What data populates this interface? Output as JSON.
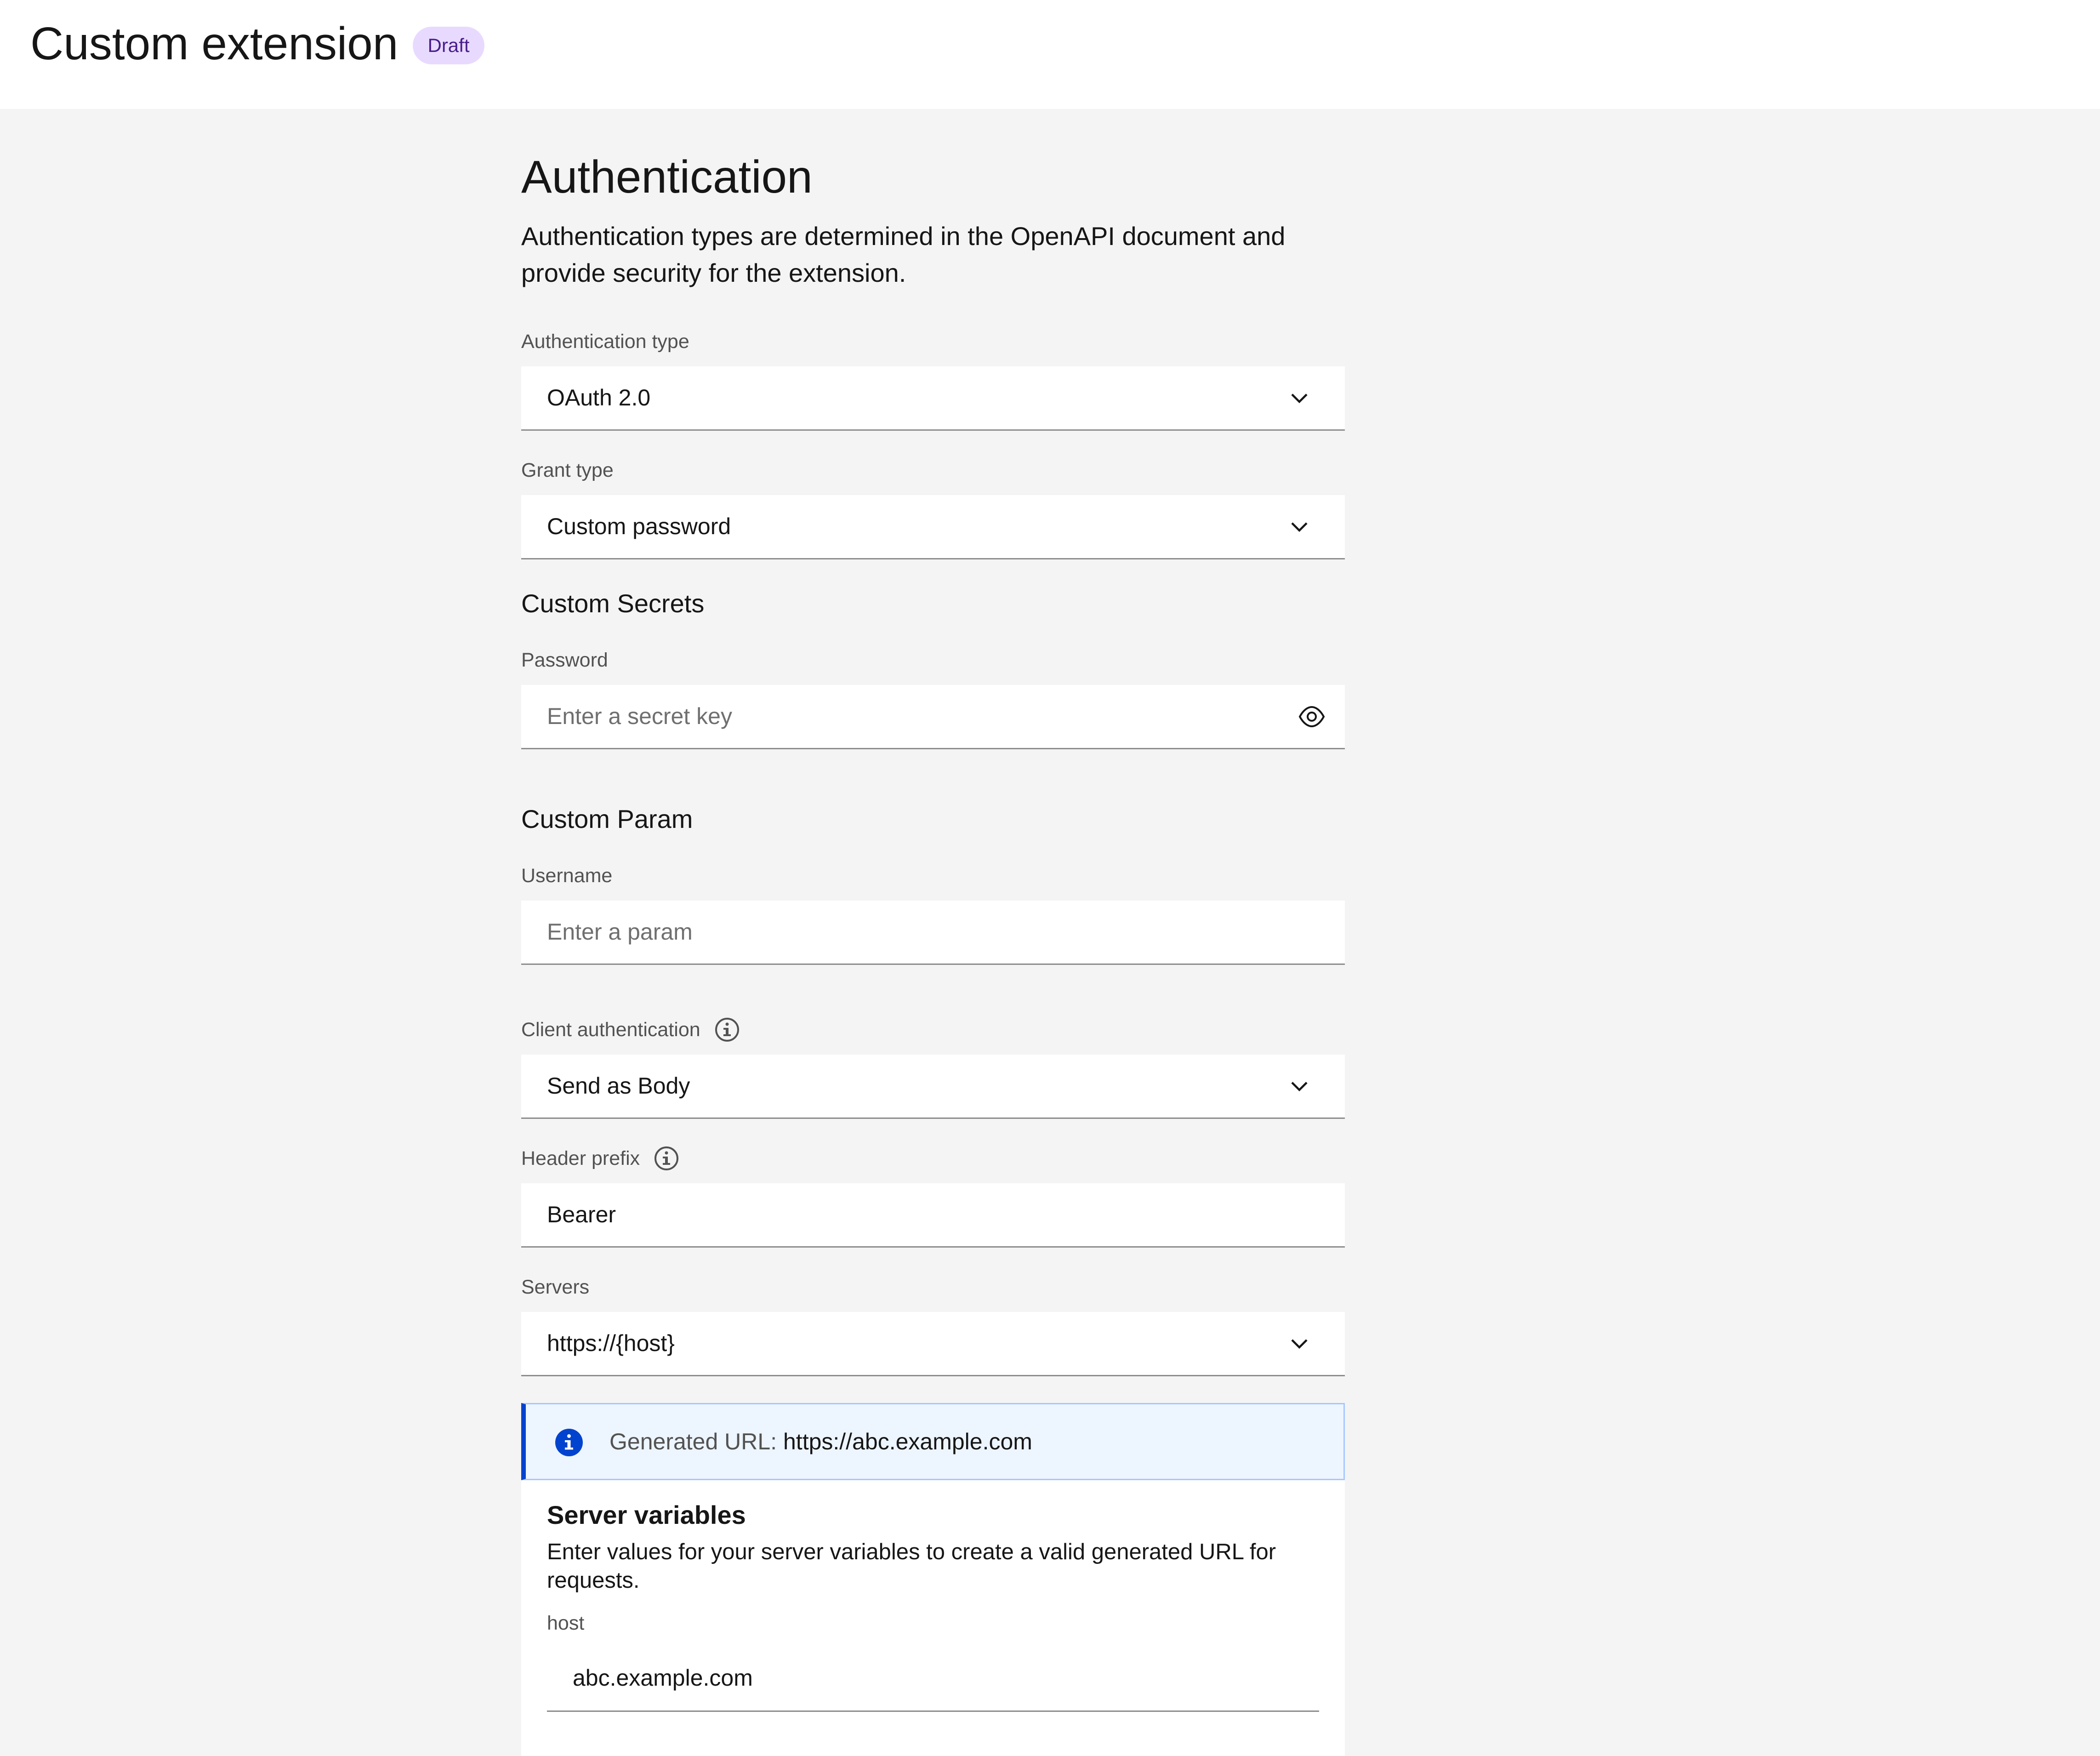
{
  "header": {
    "title": "Custom extension",
    "badge": "Draft"
  },
  "section": {
    "title": "Authentication",
    "description": "Authentication types are determined in the OpenAPI document and provide security for the extension."
  },
  "fields": {
    "auth_type": {
      "label": "Authentication type",
      "value": "OAuth 2.0"
    },
    "grant_type": {
      "label": "Grant type",
      "value": "Custom password"
    },
    "custom_secrets_title": "Custom Secrets",
    "password": {
      "label": "Password",
      "placeholder": "Enter a secret key"
    },
    "custom_param_title": "Custom Param",
    "username": {
      "label": "Username",
      "placeholder": "Enter a param"
    },
    "client_auth": {
      "label": "Client authentication",
      "value": "Send as Body"
    },
    "header_prefix": {
      "label": "Header prefix",
      "value": "Bearer"
    },
    "servers": {
      "label": "Servers",
      "value": "https://{host}"
    }
  },
  "notification": {
    "label": "Generated URL:",
    "url": "https://abc.example.com"
  },
  "server_variables": {
    "title": "Server variables",
    "description": "Enter values for your server variables to create a valid generated URL for requests.",
    "host_label": "host",
    "host_value": "abc.example.com"
  },
  "colors": {
    "page_background": "#f4f4f4",
    "badge_background": "#e8daff",
    "badge_text": "#491d8b",
    "notification_background": "#edf5ff",
    "notification_accent": "#0043ce"
  },
  "icons": {
    "chevron": "chevron-down-icon",
    "eye": "eye-icon",
    "info": "info-icon",
    "info_filled": "info-filled-icon"
  }
}
